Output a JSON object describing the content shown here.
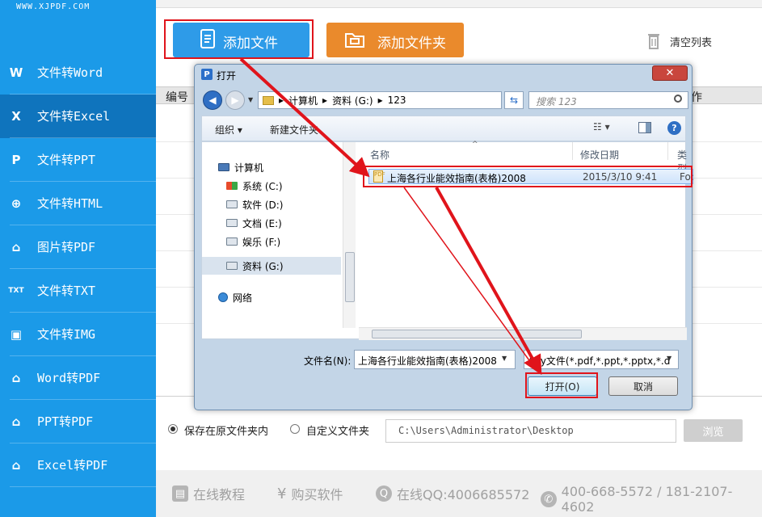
{
  "brand": {
    "url": "WWW.XJPDF.COM"
  },
  "sidebar": {
    "items": [
      {
        "label": "文件转Word",
        "icon": "W",
        "active": false
      },
      {
        "label": "文件转Excel",
        "icon": "X",
        "active": true
      },
      {
        "label": "文件转PPT",
        "icon": "P",
        "active": false
      },
      {
        "label": "文件转HTML",
        "icon": "globe",
        "active": false
      },
      {
        "label": "图片转PDF",
        "icon": "pdf",
        "active": false
      },
      {
        "label": "文件转TXT",
        "icon": "TXT",
        "active": false
      },
      {
        "label": "文件转IMG",
        "icon": "img",
        "active": false
      },
      {
        "label": "Word转PDF",
        "icon": "pdf",
        "active": false
      },
      {
        "label": "PPT转PDF",
        "icon": "pdf",
        "active": false
      },
      {
        "label": "Excel转PDF",
        "icon": "pdf",
        "active": false
      }
    ]
  },
  "toolbar": {
    "add_file": "添加文件",
    "add_folder": "添加文件夹",
    "clear_list": "清空列表"
  },
  "table": {
    "col_number": "编号",
    "col_op": "作"
  },
  "output": {
    "keep_original": "保存在原文件夹内",
    "custom_folder": "自定义文件夹",
    "path": "C:\\Users\\Administrator\\Desktop",
    "browse": "浏览"
  },
  "footer": {
    "tutorial": "在线教程",
    "buy": "购买软件",
    "qq": "在线QQ:4006685572",
    "phone": "400-668-5572 / 181-2107-4602"
  },
  "dialog": {
    "title": "打开",
    "close": "✕",
    "address": [
      "计算机",
      "资料 (G:)",
      "123"
    ],
    "search_placeholder": "搜索 123",
    "organize": "组织 ▾",
    "new_folder": "新建文件夹",
    "tree": [
      {
        "label": "计算机",
        "icon": "pc"
      },
      {
        "label": "系统 (C:)",
        "icon": "win"
      },
      {
        "label": "软件 (D:)",
        "icon": "drive"
      },
      {
        "label": "文档 (E:)",
        "icon": "drive"
      },
      {
        "label": "娱乐 (F:)",
        "icon": "drive"
      },
      {
        "label": "资料 (G:)",
        "icon": "drive"
      },
      {
        "label": "网络",
        "icon": "net"
      }
    ],
    "columns": {
      "name": "名称",
      "modified": "修改日期",
      "type": "类型"
    },
    "file": {
      "name": "上海各行业能效指南(表格)2008",
      "modified": "2015/3/10 9:41",
      "type": "Fo:"
    },
    "filename_label": "文件名(N):",
    "filename_value": "上海各行业能效指南(表格)2008",
    "filetype_value": "Any文件(*.pdf,*.ppt,*.pptx,*.d",
    "open_btn": "打开(O)",
    "cancel_btn": "取消"
  },
  "colors": {
    "sidebar": "#1b9ae8",
    "sidebar_active": "#0f74bd",
    "add_file": "#2e9be8",
    "add_folder": "#ea8a2c",
    "highlight": "#e0141b"
  }
}
